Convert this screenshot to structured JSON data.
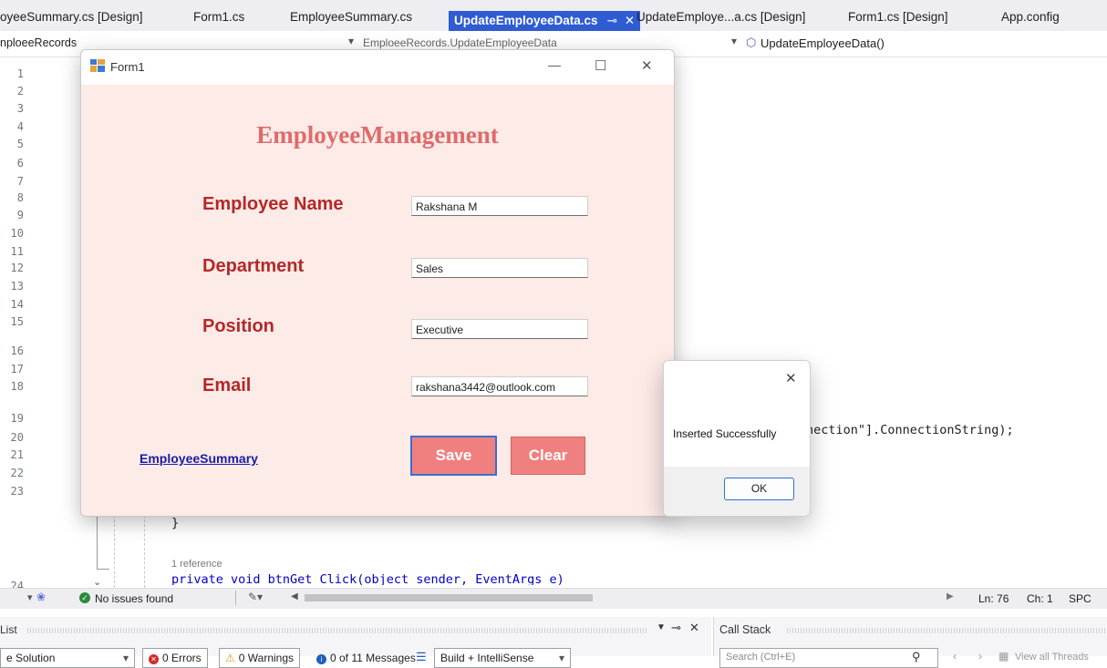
{
  "tabs": [
    {
      "label": "oyeeSummary.cs [Design]"
    },
    {
      "label": "Form1.cs"
    },
    {
      "label": "EmployeeSummary.cs"
    },
    {
      "label": "UpdateEmployeeData.cs",
      "active": true
    },
    {
      "label": "UpdateEmploye...a.cs [Design]"
    },
    {
      "label": "Form1.cs [Design]"
    },
    {
      "label": "App.config"
    }
  ],
  "navbar": {
    "project": "nploeeRecords",
    "class_path": "EmploeeRecords.UpdateEmployeeData",
    "member": "UpdateEmployeeData()"
  },
  "editor": {
    "line_numbers": [
      "1",
      "2",
      "3",
      "4",
      "5",
      "6",
      "7",
      "8",
      "9",
      "10",
      "11",
      "12",
      "13",
      "14",
      "15",
      "16",
      "17",
      "18",
      "19",
      "20",
      "21",
      "22",
      "23",
      "24"
    ],
    "code_fragment": "nection\"].ConnectionString);",
    "brace": "}",
    "reference_hint": "1 reference",
    "method_line": "private void btnGet_Click(object sender, EventArgs e)"
  },
  "form1": {
    "title": "Form1",
    "heading": "EmployeeManagement",
    "fields": [
      {
        "label": "Employee Name",
        "value": "Rakshana M"
      },
      {
        "label": "Department",
        "value": "Sales"
      },
      {
        "label": "Position",
        "value": "Executive"
      },
      {
        "label": "Email",
        "value": "rakshana3442@outlook.com"
      }
    ],
    "link": "EmployeeSummary",
    "save_label": "Save",
    "clear_label": "Clear",
    "min_glyph": "—",
    "max_glyph": "☐",
    "close_glyph": "✕"
  },
  "messagebox": {
    "message": "Inserted Successfully",
    "ok_label": "OK",
    "close_glyph": "✕"
  },
  "statusbar": {
    "zoom_dropdown": "▾",
    "issues": "No issues found",
    "ln": "Ln: 76",
    "ch": "Ch: 1",
    "spc": "SPC"
  },
  "errorlist": {
    "title": "List",
    "scope": "e Solution",
    "errors": "0 Errors",
    "warnings": "0 Warnings",
    "messages": "0 of 11 Messages",
    "build": "Build + IntelliSense"
  },
  "callstack": {
    "title": "Call Stack",
    "search_placeholder": "Search (Ctrl+E)",
    "view_threads": "View all Threads"
  },
  "colors": {
    "accent": "#2f5bd3",
    "form_bg": "#fcebe7",
    "label": "#b52828",
    "button": "#f08080",
    "heading": "#e06a6a"
  }
}
